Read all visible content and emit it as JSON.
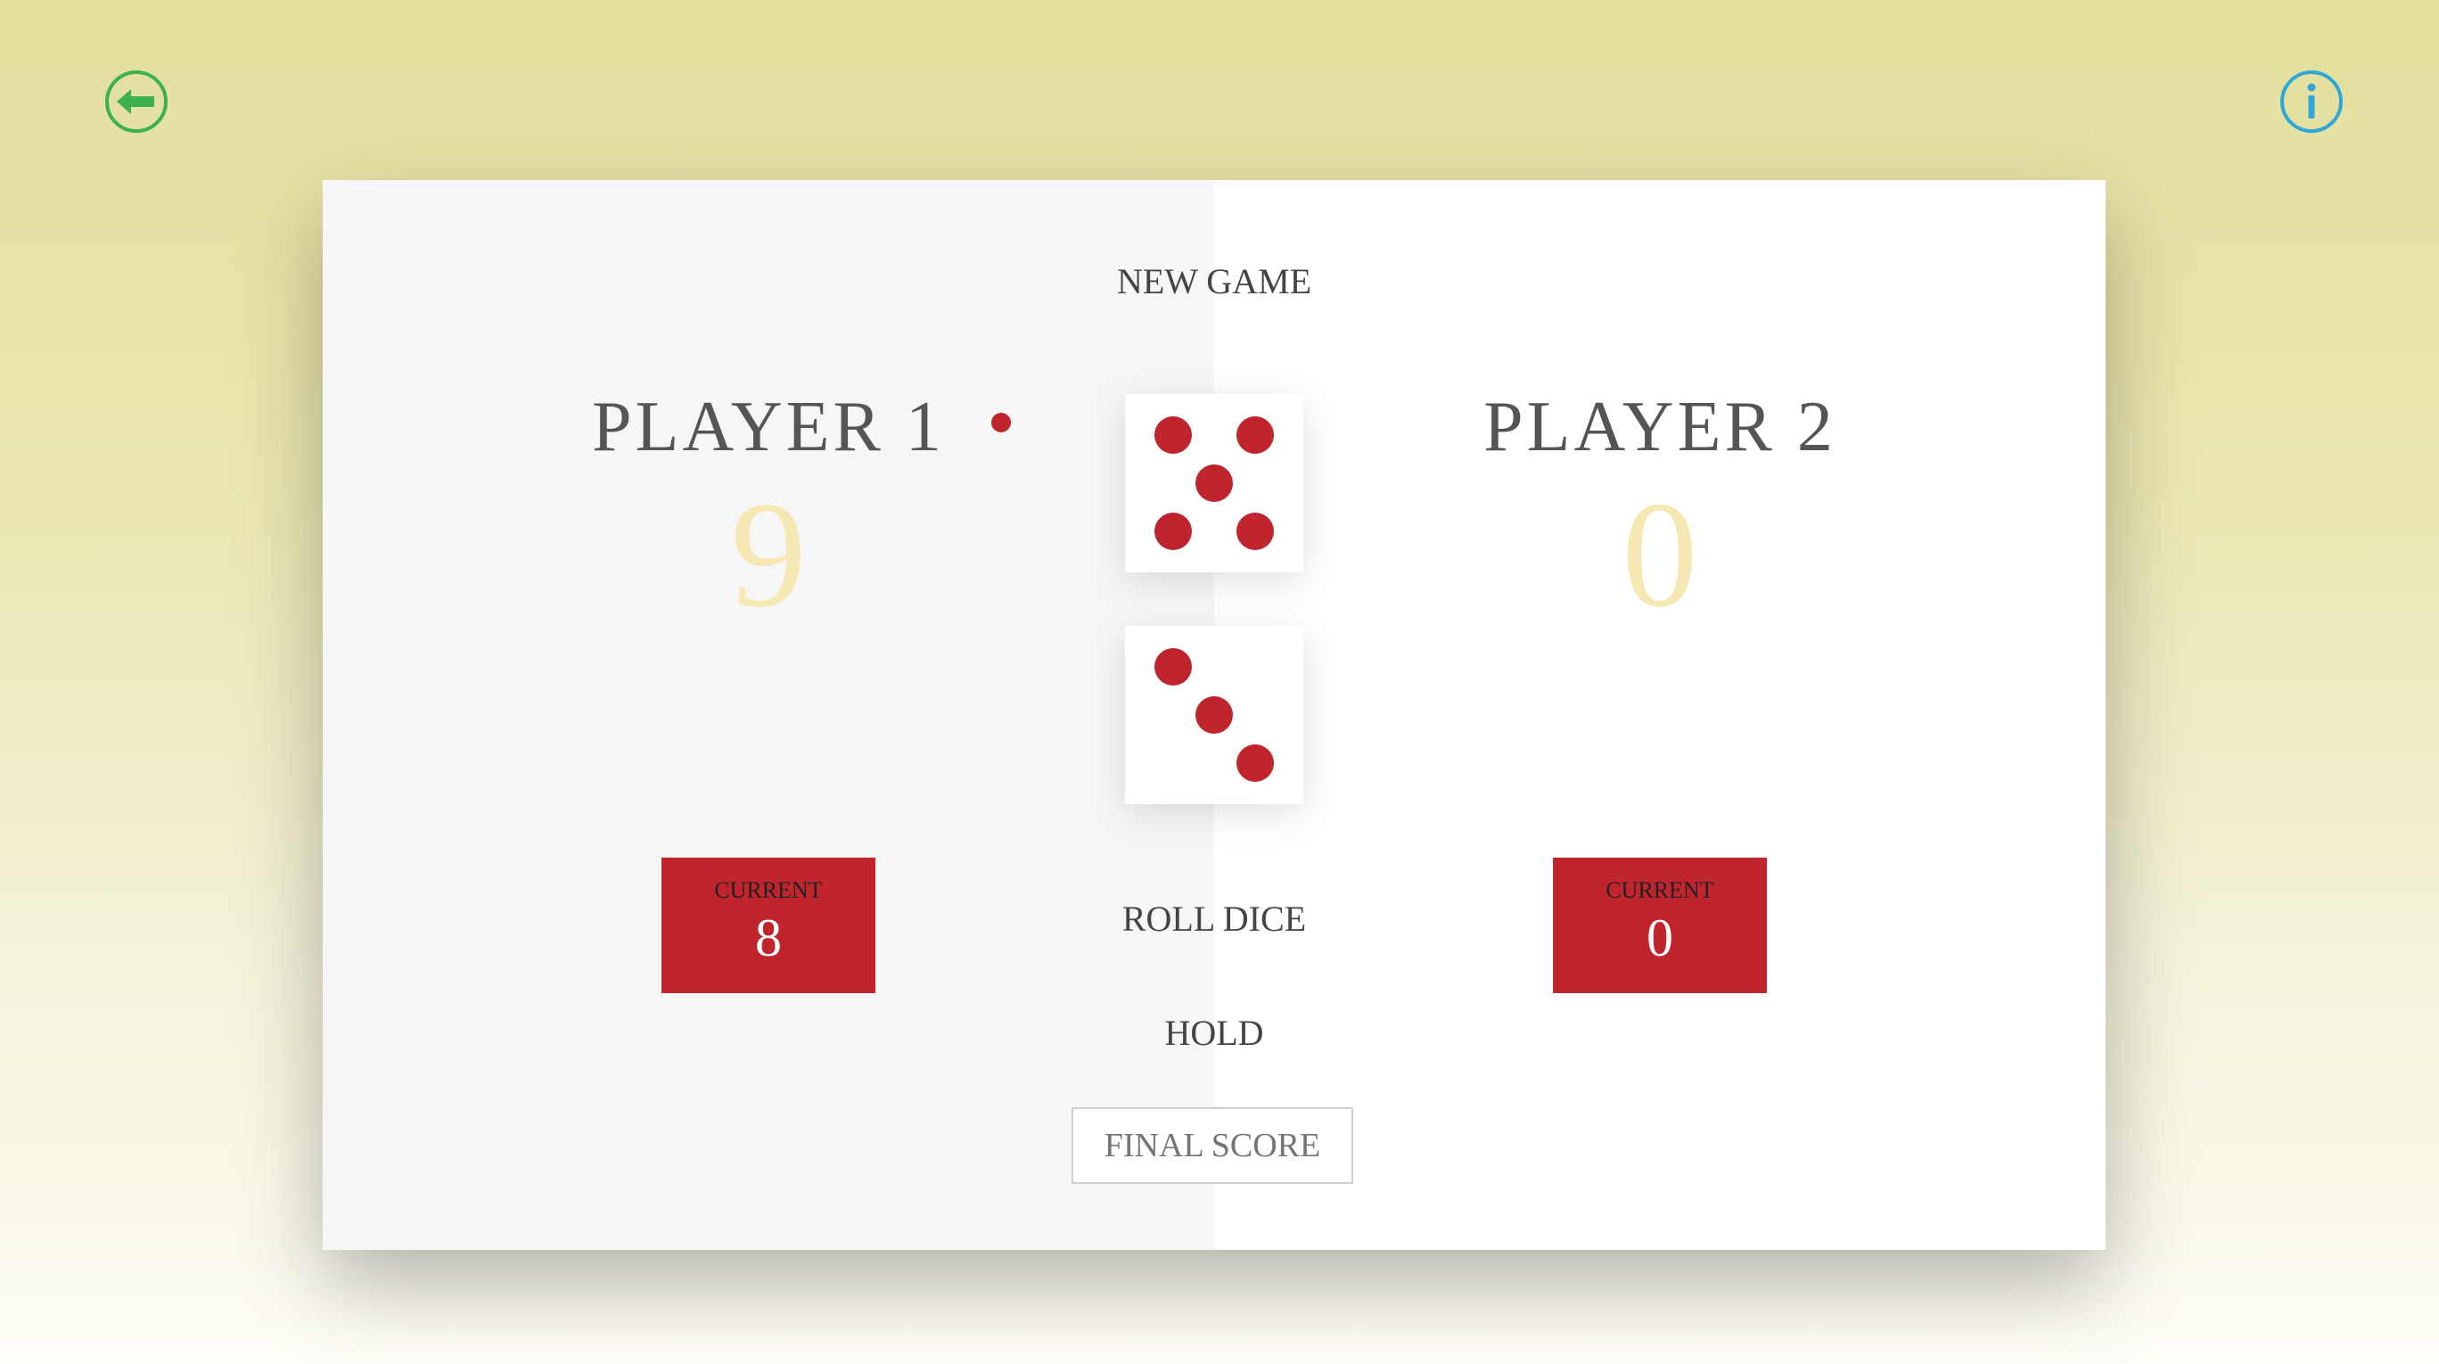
{
  "nav": {
    "back_icon": "arrow-left-circle-icon",
    "info_icon": "info-circle-icon",
    "back_color": "#3bb34a",
    "info_color": "#2fa8d8"
  },
  "players": [
    {
      "name": "PLAYER 1",
      "score": "9",
      "current_label": "CURRENT",
      "current": "8",
      "active": true
    },
    {
      "name": "PLAYER 2",
      "score": "0",
      "current_label": "CURRENT",
      "current": "0",
      "active": false
    }
  ],
  "controls": {
    "new_game": "NEW GAME",
    "roll_dice": "ROLL DICE",
    "hold": "HOLD",
    "final_score_placeholder": "FINAL SCORE"
  },
  "dice": [
    5,
    3
  ],
  "colors": {
    "accent": "#c0252e",
    "score": "#f6e8b3"
  }
}
